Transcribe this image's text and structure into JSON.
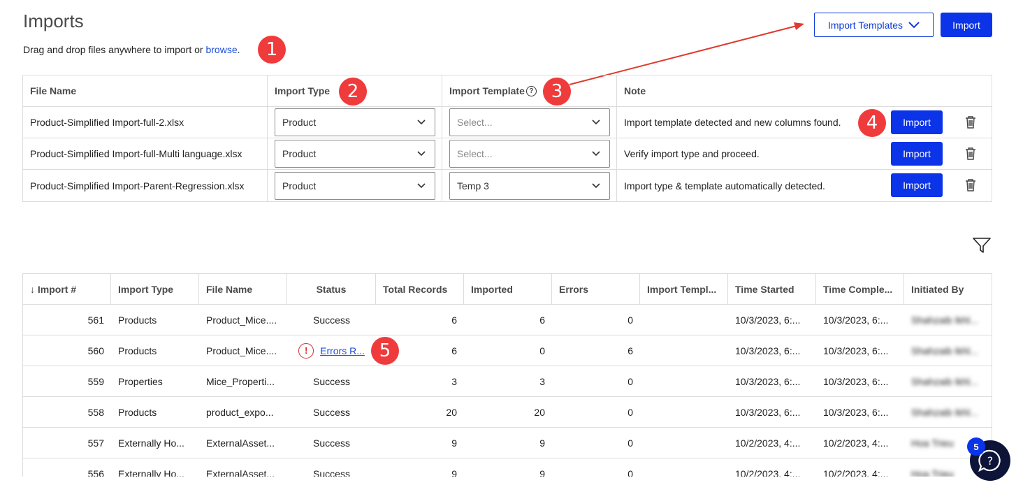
{
  "header": {
    "title": "Imports",
    "subtitle_prefix": "Drag and drop files anywhere to import or ",
    "browse_link": "browse",
    "subtitle_suffix": ".",
    "templates_button": "Import Templates",
    "import_button": "Import"
  },
  "annotations": [
    "1",
    "2",
    "3",
    "4",
    "5"
  ],
  "upload": {
    "columns": [
      "File Name",
      "Import Type",
      "Import Template",
      "Note"
    ],
    "rows": [
      {
        "file": "Product-Simplified Import-full-2.xlsx",
        "type": "Product",
        "template": "Select...",
        "note": "Import template detected and new columns found.",
        "action": "Import"
      },
      {
        "file": "Product-Simplified Import-full-Multi language.xlsx",
        "type": "Product",
        "template": "Select...",
        "note": "Verify import type and proceed.",
        "action": "Import"
      },
      {
        "file": "Product-Simplified Import-Parent-Regression.xlsx",
        "type": "Product",
        "template": "Temp 3",
        "note": "Import type & template automatically detected.",
        "action": "Import"
      }
    ]
  },
  "history": {
    "columns": [
      "↓ Import #",
      "Import Type",
      "File Name",
      "Status",
      "Total Records",
      "Imported",
      "Errors",
      "Import Templ...",
      "Time Started",
      "Time Comple...",
      "Initiated By"
    ],
    "rows": [
      {
        "num": "561",
        "type": "Products",
        "file": "Product_Mice....",
        "status": "Success",
        "total": "6",
        "imported": "6",
        "errors": "0",
        "template": "",
        "started": "10/3/2023, 6:...",
        "completed": "10/3/2023, 6:...",
        "by": "Shahzaib Ikhl..."
      },
      {
        "num": "560",
        "type": "Products",
        "file": "Product_Mice....",
        "status": "Errors R...",
        "total": "6",
        "imported": "0",
        "errors": "6",
        "template": "",
        "started": "10/3/2023, 6:...",
        "completed": "10/3/2023, 6:...",
        "by": "Shahzaib Ikhl..."
      },
      {
        "num": "559",
        "type": "Properties",
        "file": "Mice_Properti...",
        "status": "Success",
        "total": "3",
        "imported": "3",
        "errors": "0",
        "template": "",
        "started": "10/3/2023, 6:...",
        "completed": "10/3/2023, 6:...",
        "by": "Shahzaib Ikhl..."
      },
      {
        "num": "558",
        "type": "Products",
        "file": "product_expo...",
        "status": "Success",
        "total": "20",
        "imported": "20",
        "errors": "0",
        "template": "",
        "started": "10/3/2023, 6:...",
        "completed": "10/3/2023, 6:...",
        "by": "Shahzaib Ikhl..."
      },
      {
        "num": "557",
        "type": "Externally Ho...",
        "file": "ExternalAsset...",
        "status": "Success",
        "total": "9",
        "imported": "9",
        "errors": "0",
        "template": "",
        "started": "10/2/2023, 4:...",
        "completed": "10/2/2023, 4:...",
        "by": "Hoa Trieu"
      },
      {
        "num": "556",
        "type": "Externally Ho...",
        "file": "ExternalAsset...",
        "status": "Success",
        "total": "9",
        "imported": "9",
        "errors": "0",
        "template": "",
        "started": "10/2/2023, 4:...",
        "completed": "10/2/2023, 4:...",
        "by": "Hoa Trieu"
      }
    ]
  },
  "chat": {
    "badge": "5"
  },
  "colors": {
    "accent": "#0b33e8",
    "annotation": "#ef3b3b",
    "arrow": "#e03a2f",
    "error": "#d92d2d"
  }
}
